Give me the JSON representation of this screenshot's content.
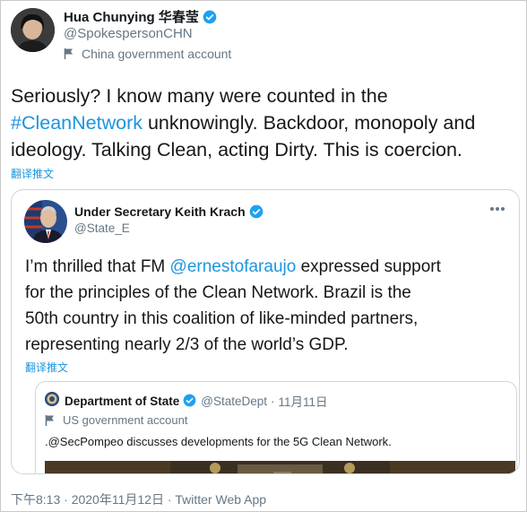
{
  "author": {
    "name": "Hua Chunying 华春莹",
    "handle": "@SpokespersonCHN",
    "account_label": "China government account",
    "verified_icon": "verified-badge-icon"
  },
  "tweet": {
    "line1": "Seriously? I know many were counted in the",
    "hashtag": "#CleanNetwork",
    "line2_rest": " unknowingly. Backdoor, monopoly and",
    "line3": "ideology. Talking Clean, acting Dirty. This is coercion.",
    "translate_label": "翻译推文"
  },
  "quoted": {
    "name": "Under Secretary Keith Krach",
    "handle": "@State_E",
    "text_line1_pre": "I’m thrilled that FM ",
    "mention": "@ernestofaraujo",
    "text_line1_post": " expressed support",
    "text_line2": "for the principles of the Clean Network. Brazil is the",
    "text_line3": "50th country in this coalition of like-minded partners,",
    "text_line4": "representing nearly 2/3 of the world’s GDP.",
    "translate_label": "翻译推文",
    "more_icon": "more-options-icon"
  },
  "nested": {
    "name": "Department of State",
    "handle": "@StateDept",
    "date": "11月11日",
    "separator": "·",
    "account_label": "US government account",
    "text": ".@SecPompeo discusses developments for the 5G Clean Network."
  },
  "footer": {
    "text": "下午8:13 · 2020年11月12日 · Twitter Web App"
  },
  "colors": {
    "link": "#1b95e0",
    "verified": "#1da1f2",
    "secondary_text": "#657786",
    "border": "#ccd6dd"
  }
}
